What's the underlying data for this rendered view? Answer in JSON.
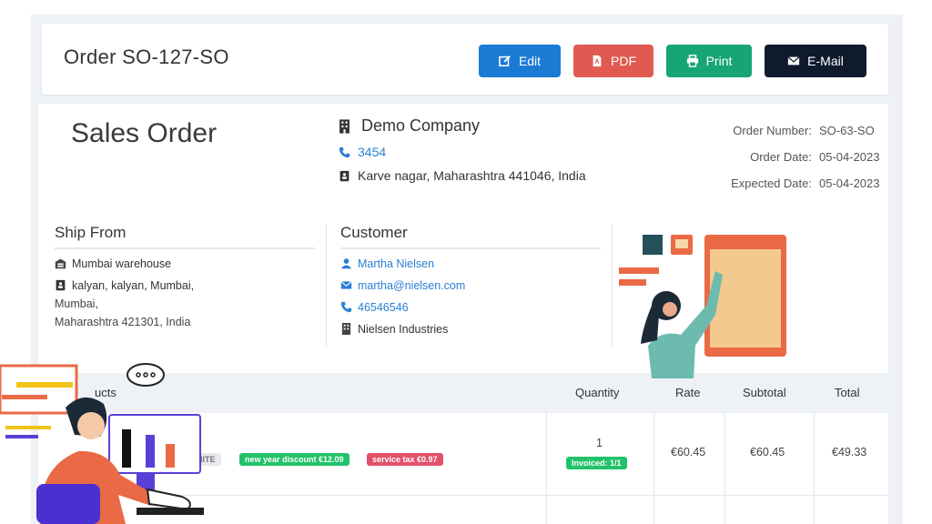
{
  "header": {
    "order_title": "Order SO-127-SO",
    "buttons": {
      "edit": "Edit",
      "pdf": "PDF",
      "print": "Print",
      "email": "E-Mail"
    }
  },
  "document": {
    "title": "Sales Order",
    "company": {
      "name": "Demo Company",
      "phone": "3454",
      "address": "Karve nagar, Maharashtra 441046, India"
    },
    "meta": [
      {
        "label": "Order Number:",
        "value": "SO-63-SO"
      },
      {
        "label": "Order Date:",
        "value": "05-04-2023"
      },
      {
        "label": "Expected Date:",
        "value": "05-04-2023"
      }
    ]
  },
  "ship_from": {
    "title": "Ship From",
    "warehouse": "Mumbai warehouse",
    "address_line1": "kalyan, kalyan, Mumbai,",
    "address_line2": "Mumbai,",
    "address_line3": "Maharashtra 421301, India"
  },
  "customer": {
    "title": "Customer",
    "name": "Martha Nielsen",
    "email": "martha@nielsen.com",
    "phone": "46546546",
    "company": "Nielsen Industries"
  },
  "table": {
    "headers": {
      "products": "ucts",
      "quantity": "Quantity",
      "rate": "Rate",
      "subtotal": "Subtotal",
      "total": "Total"
    },
    "row": {
      "variant_tag": "HITE",
      "discount": "new year discount €12.09",
      "tax": "service tax €0.97",
      "quantity": "1",
      "invoiced": "Invoiced: 1/1",
      "rate": "€60.45",
      "subtotal": "€60.45",
      "total": "€49.33"
    }
  },
  "colors": {
    "edit": "#1a7ad4",
    "pdf": "#e05a51",
    "print": "#17a673",
    "email": "#0f1a2d",
    "link": "#2a7fd4"
  }
}
